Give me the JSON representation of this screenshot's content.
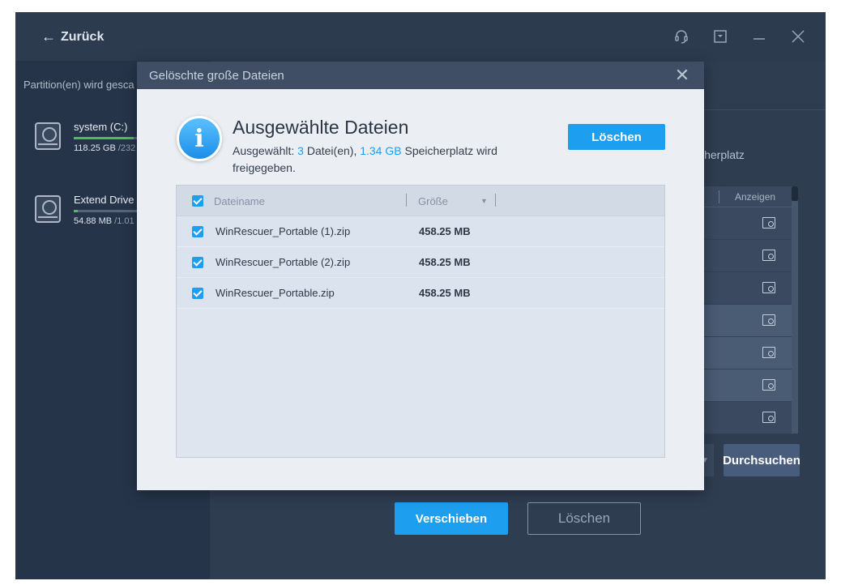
{
  "header": {
    "back_label": "Zurück"
  },
  "sidebar": {
    "status": "Partition(en) wird gesca",
    "drives": [
      {
        "name": "system (C:)",
        "used": "118.25 GB",
        "total": " /232",
        "fill": 0.62
      },
      {
        "name": "Extend Drive",
        "used": "54.88 MB",
        "total": " /1.01",
        "fill": 0.04
      }
    ]
  },
  "main": {
    "free_text": "icherplatz",
    "column_view": "Anzeigen",
    "browse_label": "Durchsuchen",
    "move_label": "Verschieben",
    "delete_label": "Löschen"
  },
  "dialog": {
    "title": "Gelöschte große Dateien",
    "heading": "Ausgewählte Dateien",
    "info_glyph": "i",
    "selected_prefix": "Ausgewählt: ",
    "selected_count": "3",
    "selected_mid": " Datei(en), ",
    "selected_size": "1.34 GB",
    "selected_suffix": " Speicherplatz wird freigegeben.",
    "delete_label": "Löschen",
    "table": {
      "col_name": "Dateiname",
      "col_size": "Größe",
      "rows": [
        {
          "name": "WinRescuer_Portable (1).zip",
          "size": "458.25 MB"
        },
        {
          "name": "WinRescuer_Portable (2).zip",
          "size": "458.25 MB"
        },
        {
          "name": "WinRescuer_Portable.zip",
          "size": "458.25 MB"
        }
      ]
    }
  },
  "colors": {
    "accent": "#1e9eef",
    "window_bg": "#2f3d51",
    "dialog_bg": "#ebeff4"
  }
}
